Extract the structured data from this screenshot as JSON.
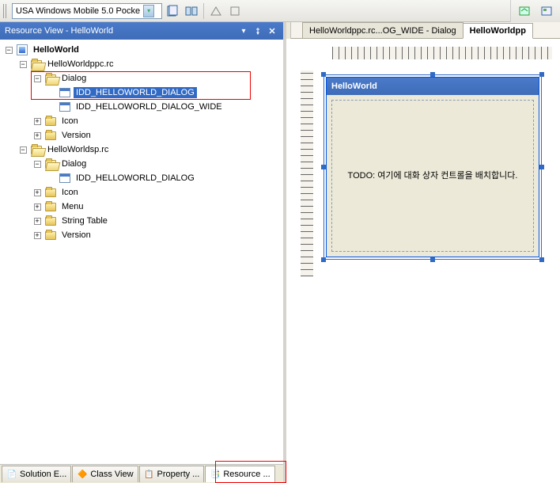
{
  "toolbar": {
    "platform_combo": "USA Windows Mobile 5.0 Pocke"
  },
  "pane": {
    "title": "Resource View - HelloWorld"
  },
  "tree": {
    "root": "HelloWorld",
    "rc1": {
      "name": "HelloWorldppc.rc",
      "dialog": "Dialog",
      "d1": "IDD_HELLOWORLD_DIALOG",
      "d2": "IDD_HELLOWORLD_DIALOG_WIDE",
      "icon": "Icon",
      "version": "Version"
    },
    "rc2": {
      "name": "HelloWorldsp.rc",
      "dialog": "Dialog",
      "d1": "IDD_HELLOWORLD_DIALOG",
      "icon": "Icon",
      "menu": "Menu",
      "strtab": "String Table",
      "version": "Version"
    }
  },
  "bottom_tabs": {
    "t1": "Solution E...",
    "t2": "Class View",
    "t3": "Property ...",
    "t4": "Resource ..."
  },
  "doc_tabs": {
    "t1": "HelloWorldppc.rc...OG_WIDE - Dialog",
    "t2": "HelloWorldpp"
  },
  "dialog_preview": {
    "title": "HelloWorld",
    "body": "TODO: 여기에 대화 상자 컨트롤을 배치합니다."
  }
}
